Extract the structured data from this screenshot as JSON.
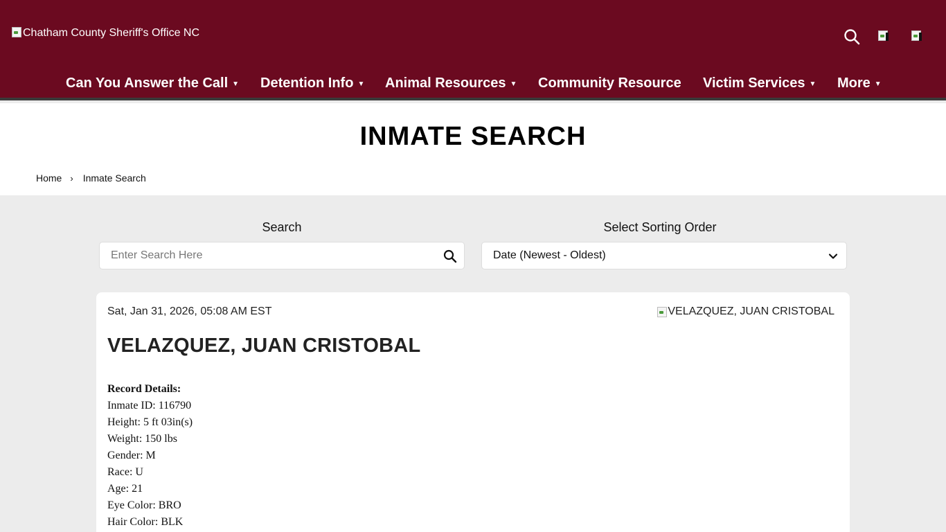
{
  "header": {
    "logo_alt": "Chatham County Sheriff's Office NC",
    "icons": [
      "search-icon",
      "facebook-icon",
      "twitter-icon"
    ]
  },
  "nav": [
    {
      "label": "Can You Answer the Call",
      "dropdown": true
    },
    {
      "label": "Detention Info",
      "dropdown": true
    },
    {
      "label": "Animal Resources",
      "dropdown": true
    },
    {
      "label": "Community Resource",
      "dropdown": false
    },
    {
      "label": "Victim Services",
      "dropdown": true
    },
    {
      "label": "More",
      "dropdown": true
    }
  ],
  "page": {
    "title": "INMATE SEARCH",
    "breadcrumb": [
      "Home",
      "Inmate Search"
    ]
  },
  "search": {
    "label": "Search",
    "placeholder": "Enter Search Here",
    "value": ""
  },
  "sort": {
    "label": "Select Sorting Order",
    "selected": "Date (Newest - Oldest)"
  },
  "record": {
    "timestamp": "Sat, Jan 31, 2026, 05:08 AM EST",
    "photo_alt": "VELAZQUEZ, JUAN CRISTOBAL",
    "name": "VELAZQUEZ, JUAN CRISTOBAL",
    "details_heading": "Record Details:",
    "details": [
      "Inmate ID: 116790",
      "Height: 5 ft 03in(s)",
      "Weight: 150 lbs",
      "Gender: M",
      "Race: U",
      "Age: 21",
      "Eye Color: BRO",
      "Hair Color: BLK"
    ]
  },
  "colors": {
    "header_bg": "#6b0a20",
    "page_bg": "#ececec",
    "card_bg": "#ffffff"
  }
}
